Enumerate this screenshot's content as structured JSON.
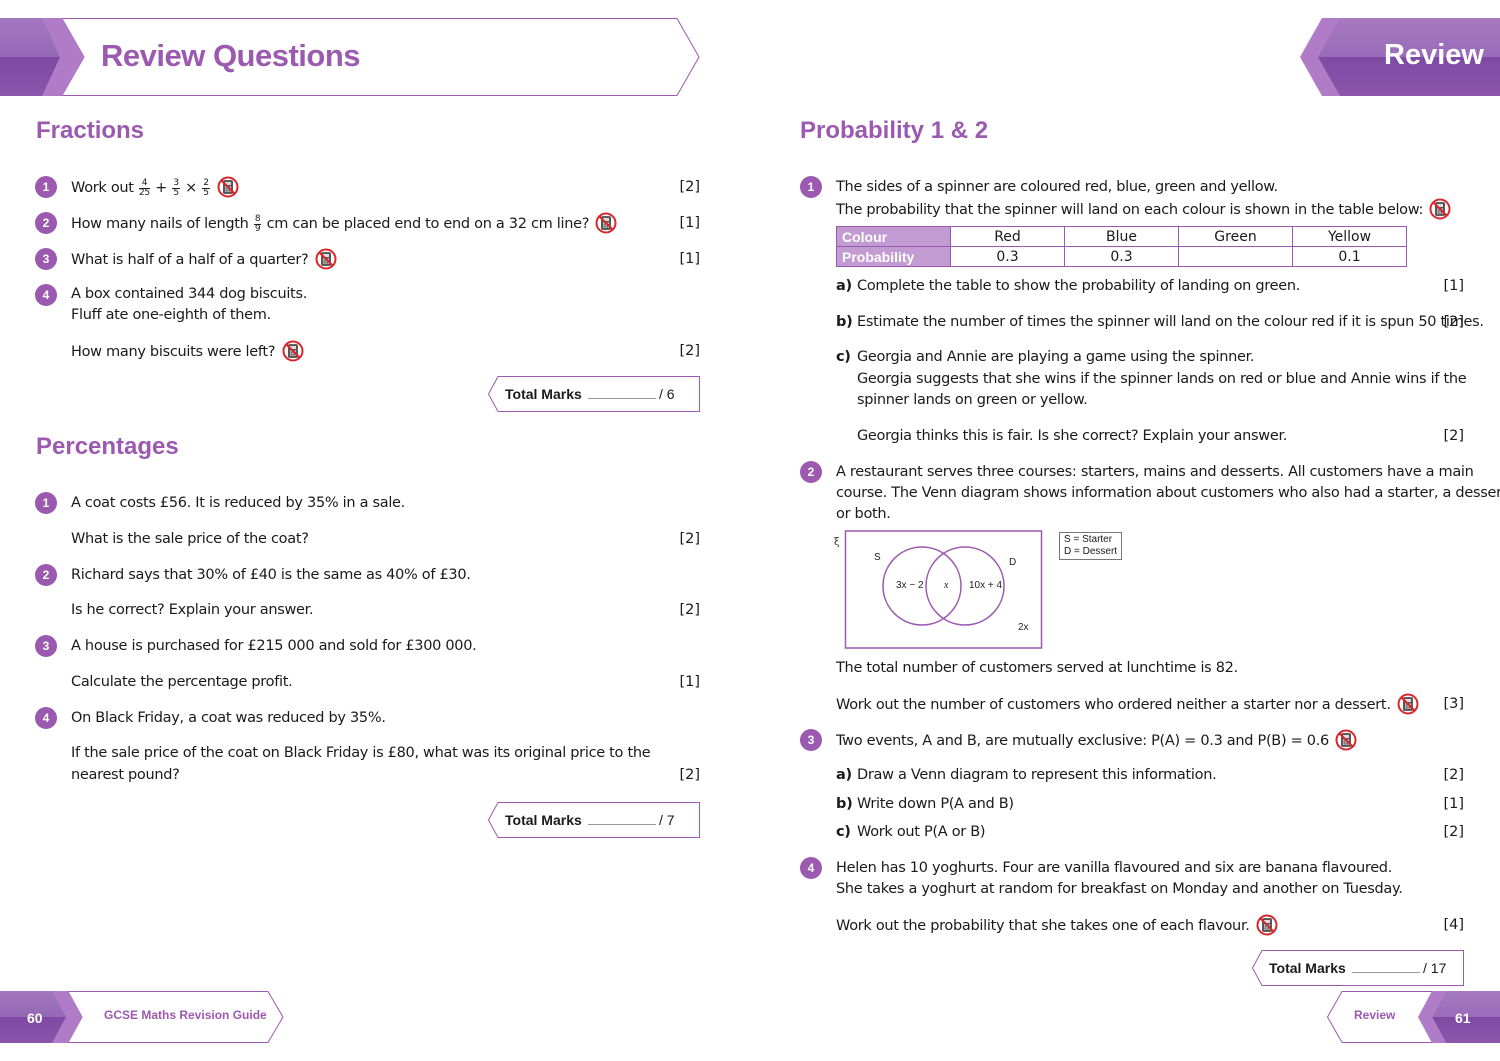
{
  "header": {
    "left_title": "Review Questions",
    "right_title": "Review"
  },
  "colors": {
    "accent": "#9b59b0",
    "accent_dark": "#7d4aa3",
    "accent_light": "#c39bd3",
    "no_calculator": "#d9262b"
  },
  "icons": {
    "no_calculator": "no-calculator-icon"
  },
  "fractions": {
    "heading": "Fractions",
    "questions": [
      {
        "num": "1",
        "text_prefix": "Work out",
        "f1": {
          "n": "4",
          "d": "25"
        },
        "op1": "+",
        "f2": {
          "n": "3",
          "d": "5"
        },
        "op2": "×",
        "f3": {
          "n": "2",
          "d": "5"
        },
        "marks": "[2]"
      },
      {
        "num": "2",
        "text_prefix": "How many nails of length",
        "f1": {
          "n": "8",
          "d": "9"
        },
        "text_suffix": "cm can be placed end to end on a 32 cm line?",
        "marks": "[1]"
      },
      {
        "num": "3",
        "text": "What is half of a half of a quarter?",
        "marks": "[1]"
      },
      {
        "num": "4",
        "lines": [
          "A box contained 344 dog biscuits.",
          "Fluff ate one-eighth of them."
        ],
        "followup": "How many biscuits were left?",
        "marks": "[2]"
      }
    ],
    "total": {
      "label": "Total Marks",
      "out_of": "/ 6"
    }
  },
  "percentages": {
    "heading": "Percentages",
    "questions": [
      {
        "num": "1",
        "text": "A coat costs £56. It is reduced by 35% in a sale.",
        "followup": "What is the sale price of the coat?",
        "marks": "[2]"
      },
      {
        "num": "2",
        "text": "Richard says that 30% of £40 is the same as 40% of £30.",
        "followup": "Is he correct? Explain your answer.",
        "marks": "[2]"
      },
      {
        "num": "3",
        "text": "A house is purchased for £215 000 and sold for £300 000.",
        "followup": "Calculate the percentage profit.",
        "marks": "[1]"
      },
      {
        "num": "4",
        "text": "On Black Friday, a coat was reduced by 35%.",
        "followup_lines": [
          "If the sale price of the coat on Black Friday is £80, what was its original price to the",
          "nearest pound?"
        ],
        "marks": "[2]"
      }
    ],
    "total": {
      "label": "Total Marks",
      "out_of": "/ 7"
    }
  },
  "probability": {
    "heading": "Probability 1 & 2",
    "q1": {
      "num": "1",
      "lines": [
        "The sides of a spinner are coloured red, blue, green and yellow.",
        "The probability that the spinner will land on each colour is shown in the table below:"
      ],
      "table": {
        "row_headers": [
          "Colour",
          "Probability"
        ],
        "colours": [
          "Red",
          "Blue",
          "Green",
          "Yellow"
        ],
        "probabilities": [
          "0.3",
          "0.3",
          "",
          "0.1"
        ]
      },
      "parts": [
        {
          "label": "a)",
          "text": "Complete the table to show the probability of landing on green.",
          "marks": "[1]"
        },
        {
          "label": "b)",
          "text": "Estimate the number of times the spinner will land on the colour red if it is spun 50 times.",
          "marks": "[2]"
        },
        {
          "label": "c)",
          "lines": [
            "Georgia and Annie are playing a game using the spinner.",
            "Georgia suggests that she wins if the spinner lands on red or blue and Annie wins if the",
            "spinner lands on green or yellow."
          ],
          "followup": "Georgia thinks this is fair. Is she correct? Explain your answer.",
          "marks": "[2]"
        }
      ]
    },
    "q2": {
      "num": "2",
      "lines": [
        "A restaurant serves three courses: starters, mains and desserts. All customers have a main",
        "course. The Venn diagram shows information about customers who also had a starter, a dessert",
        "or both."
      ],
      "venn": {
        "universal_symbol": "ξ",
        "set_a_label": "S",
        "set_b_label": "D",
        "only_a": "3x − 2",
        "intersection": "x",
        "only_b": "10x + 4",
        "outside": "2x",
        "key": [
          "S = Starter",
          "D = Dessert"
        ]
      },
      "info": "The total number of customers served at lunchtime is 82.",
      "question": "Work out the number of customers who ordered neither a starter nor a dessert.",
      "marks": "[3]"
    },
    "q3": {
      "num": "3",
      "text": "Two events, A and B, are mutually exclusive:  P(A) = 0.3 and P(B) = 0.6",
      "parts": [
        {
          "label": "a)",
          "text": "Draw a Venn diagram to represent this information.",
          "marks": "[2]"
        },
        {
          "label": "b)",
          "text": "Write down P(A and B)",
          "marks": "[1]"
        },
        {
          "label": "c)",
          "text": "Work out P(A or B)",
          "marks": "[2]"
        }
      ]
    },
    "q4": {
      "num": "4",
      "lines": [
        "Helen has 10 yoghurts. Four are vanilla flavoured and six are banana flavoured.",
        "She takes a yoghurt at random for breakfast on Monday and another on Tuesday."
      ],
      "question": "Work out the probability that she takes one of each flavour.",
      "marks": "[4]"
    },
    "total": {
      "label": "Total Marks",
      "out_of": "/ 17"
    }
  },
  "footer": {
    "left_page": "60",
    "left_text": "GCSE Maths Revision Guide",
    "right_text": "Review",
    "right_page": "61"
  }
}
